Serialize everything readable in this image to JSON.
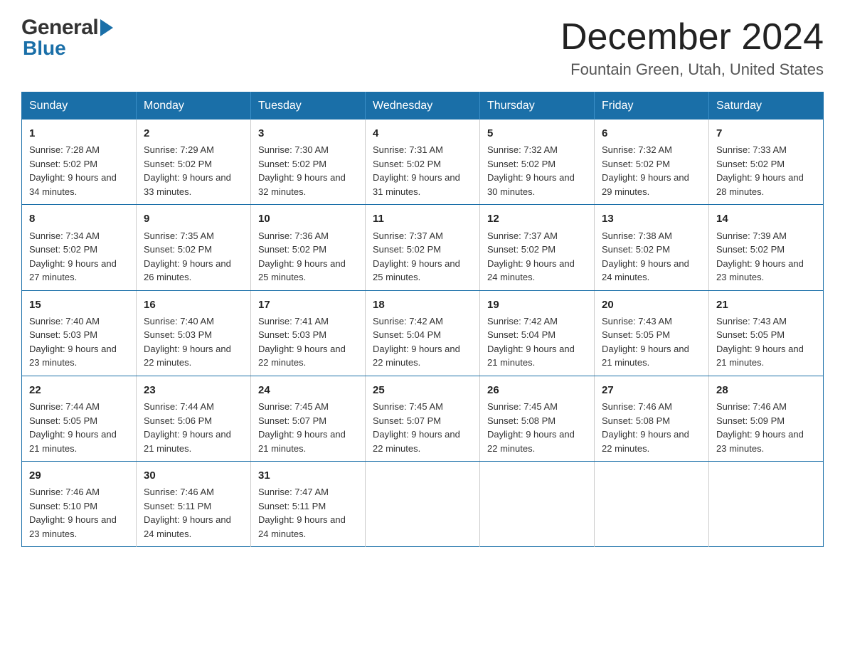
{
  "header": {
    "logo": {
      "general": "General",
      "blue": "Blue",
      "arrow": "►"
    },
    "month_title": "December 2024",
    "location": "Fountain Green, Utah, United States"
  },
  "weekdays": [
    "Sunday",
    "Monday",
    "Tuesday",
    "Wednesday",
    "Thursday",
    "Friday",
    "Saturday"
  ],
  "weeks": [
    [
      {
        "day": "1",
        "sunrise": "7:28 AM",
        "sunset": "5:02 PM",
        "daylight": "9 hours and 34 minutes."
      },
      {
        "day": "2",
        "sunrise": "7:29 AM",
        "sunset": "5:02 PM",
        "daylight": "9 hours and 33 minutes."
      },
      {
        "day": "3",
        "sunrise": "7:30 AM",
        "sunset": "5:02 PM",
        "daylight": "9 hours and 32 minutes."
      },
      {
        "day": "4",
        "sunrise": "7:31 AM",
        "sunset": "5:02 PM",
        "daylight": "9 hours and 31 minutes."
      },
      {
        "day": "5",
        "sunrise": "7:32 AM",
        "sunset": "5:02 PM",
        "daylight": "9 hours and 30 minutes."
      },
      {
        "day": "6",
        "sunrise": "7:32 AM",
        "sunset": "5:02 PM",
        "daylight": "9 hours and 29 minutes."
      },
      {
        "day": "7",
        "sunrise": "7:33 AM",
        "sunset": "5:02 PM",
        "daylight": "9 hours and 28 minutes."
      }
    ],
    [
      {
        "day": "8",
        "sunrise": "7:34 AM",
        "sunset": "5:02 PM",
        "daylight": "9 hours and 27 minutes."
      },
      {
        "day": "9",
        "sunrise": "7:35 AM",
        "sunset": "5:02 PM",
        "daylight": "9 hours and 26 minutes."
      },
      {
        "day": "10",
        "sunrise": "7:36 AM",
        "sunset": "5:02 PM",
        "daylight": "9 hours and 25 minutes."
      },
      {
        "day": "11",
        "sunrise": "7:37 AM",
        "sunset": "5:02 PM",
        "daylight": "9 hours and 25 minutes."
      },
      {
        "day": "12",
        "sunrise": "7:37 AM",
        "sunset": "5:02 PM",
        "daylight": "9 hours and 24 minutes."
      },
      {
        "day": "13",
        "sunrise": "7:38 AM",
        "sunset": "5:02 PM",
        "daylight": "9 hours and 24 minutes."
      },
      {
        "day": "14",
        "sunrise": "7:39 AM",
        "sunset": "5:02 PM",
        "daylight": "9 hours and 23 minutes."
      }
    ],
    [
      {
        "day": "15",
        "sunrise": "7:40 AM",
        "sunset": "5:03 PM",
        "daylight": "9 hours and 23 minutes."
      },
      {
        "day": "16",
        "sunrise": "7:40 AM",
        "sunset": "5:03 PM",
        "daylight": "9 hours and 22 minutes."
      },
      {
        "day": "17",
        "sunrise": "7:41 AM",
        "sunset": "5:03 PM",
        "daylight": "9 hours and 22 minutes."
      },
      {
        "day": "18",
        "sunrise": "7:42 AM",
        "sunset": "5:04 PM",
        "daylight": "9 hours and 22 minutes."
      },
      {
        "day": "19",
        "sunrise": "7:42 AM",
        "sunset": "5:04 PM",
        "daylight": "9 hours and 21 minutes."
      },
      {
        "day": "20",
        "sunrise": "7:43 AM",
        "sunset": "5:05 PM",
        "daylight": "9 hours and 21 minutes."
      },
      {
        "day": "21",
        "sunrise": "7:43 AM",
        "sunset": "5:05 PM",
        "daylight": "9 hours and 21 minutes."
      }
    ],
    [
      {
        "day": "22",
        "sunrise": "7:44 AM",
        "sunset": "5:05 PM",
        "daylight": "9 hours and 21 minutes."
      },
      {
        "day": "23",
        "sunrise": "7:44 AM",
        "sunset": "5:06 PM",
        "daylight": "9 hours and 21 minutes."
      },
      {
        "day": "24",
        "sunrise": "7:45 AM",
        "sunset": "5:07 PM",
        "daylight": "9 hours and 21 minutes."
      },
      {
        "day": "25",
        "sunrise": "7:45 AM",
        "sunset": "5:07 PM",
        "daylight": "9 hours and 22 minutes."
      },
      {
        "day": "26",
        "sunrise": "7:45 AM",
        "sunset": "5:08 PM",
        "daylight": "9 hours and 22 minutes."
      },
      {
        "day": "27",
        "sunrise": "7:46 AM",
        "sunset": "5:08 PM",
        "daylight": "9 hours and 22 minutes."
      },
      {
        "day": "28",
        "sunrise": "7:46 AM",
        "sunset": "5:09 PM",
        "daylight": "9 hours and 23 minutes."
      }
    ],
    [
      {
        "day": "29",
        "sunrise": "7:46 AM",
        "sunset": "5:10 PM",
        "daylight": "9 hours and 23 minutes."
      },
      {
        "day": "30",
        "sunrise": "7:46 AM",
        "sunset": "5:11 PM",
        "daylight": "9 hours and 24 minutes."
      },
      {
        "day": "31",
        "sunrise": "7:47 AM",
        "sunset": "5:11 PM",
        "daylight": "9 hours and 24 minutes."
      },
      null,
      null,
      null,
      null
    ]
  ]
}
